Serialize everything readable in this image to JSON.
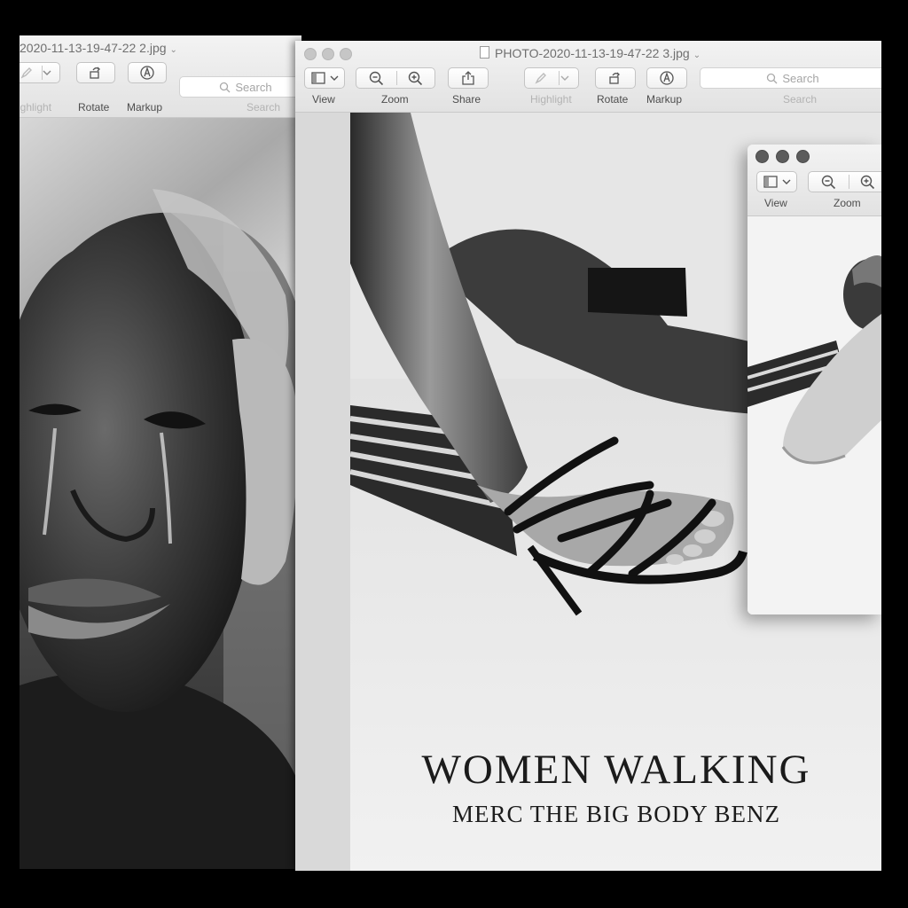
{
  "windows": {
    "back": {
      "title": "2020-11-13-19-47-22 2.jpg",
      "toolbar": {
        "highlight_label": "ighlight",
        "rotate_label": "Rotate",
        "markup_label": "Markup",
        "search_placeholder": "Search",
        "search_label": "Search"
      }
    },
    "main": {
      "title": "PHOTO-2020-11-13-19-47-22 3.jpg",
      "toolbar": {
        "view_label": "View",
        "zoom_label": "Zoom",
        "share_label": "Share",
        "highlight_label": "Highlight",
        "rotate_label": "Rotate",
        "markup_label": "Markup",
        "search_placeholder": "Search",
        "search_label": "Search"
      },
      "cover": {
        "title": "WOMEN WALKING",
        "subtitle": "MERC THE BIG BODY BENZ"
      }
    },
    "small": {
      "toolbar": {
        "view_label": "View",
        "zoom_label": "Zoom"
      }
    }
  },
  "icons": {
    "sidebar_toggle": "sidebar-icon",
    "zoom_out": "zoom-out-icon",
    "zoom_in": "zoom-in-icon",
    "share": "share-icon",
    "highlight": "pen-icon",
    "rotate": "rotate-icon",
    "markup": "markup-icon",
    "search": "magnifier-icon"
  },
  "colors": {
    "background": "#000000",
    "toolbar": "#ececec",
    "photo_bw": "#e8e8e8"
  }
}
